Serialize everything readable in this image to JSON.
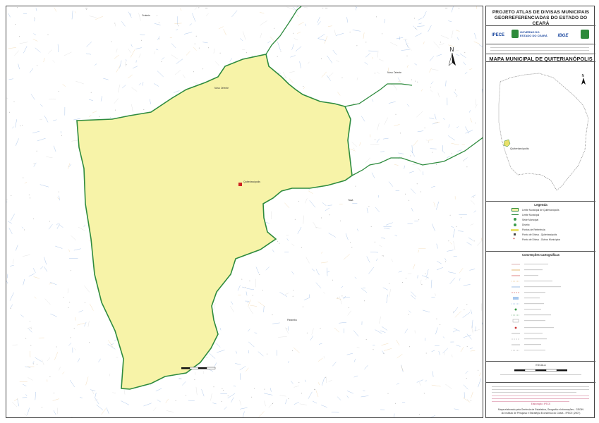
{
  "header": {
    "title_line1": "PROJETO ATLAS DE DIVISAS MUNICIPAIS",
    "title_line2": "GEORREFERENCIADAS DO ESTADO DO CEARÁ"
  },
  "logos": {
    "ipece": "IPECE",
    "governo_line1": "GOVERNO DO",
    "governo_line2": "ESTADO DO CEARÁ",
    "ibge": "IBGE"
  },
  "map_title": "MAPA MUNICIPAL DE QUITERIANÓPOLIS",
  "north_label": "N",
  "inset_label": "Quiterianópolis",
  "places": {
    "seat": "Quiterianópolis",
    "north_west": "Novo Oriente",
    "north_east": "Novo Oriente",
    "east": "Tauá",
    "south_east": "Parambu",
    "top": "Crateús"
  },
  "colors": {
    "municipality_fill": "#f7f3a8",
    "boundary": "#2e8b3e",
    "drainage": "#5b8fd6",
    "roads": "#e0a850",
    "seat_marker": "#cc2222"
  },
  "legend": {
    "title": "Legenda",
    "items": [
      "Limite Municipal de Quiterianópolis",
      "Limite Municipal",
      "Sede Municipal",
      "Distrito",
      "Pontos de Referência",
      "Ponto de Divisa - Quiterianópolis",
      "Ponto de Divisa - Outros Municípios"
    ]
  },
  "conventions": {
    "title": "Convenções Cartográficas"
  },
  "scale": {
    "label": "ESCALA"
  },
  "credits": {
    "pink_line1": "Elaboração: IPECE",
    "dark_line1": "Mapa elaborado pela Gerência de Estatística, Geografia e Informações - GEGIN",
    "dark_line2": "do Instituto de Pesquisa e Estratégia Econômica do Ceará - IPECE (2007)"
  }
}
